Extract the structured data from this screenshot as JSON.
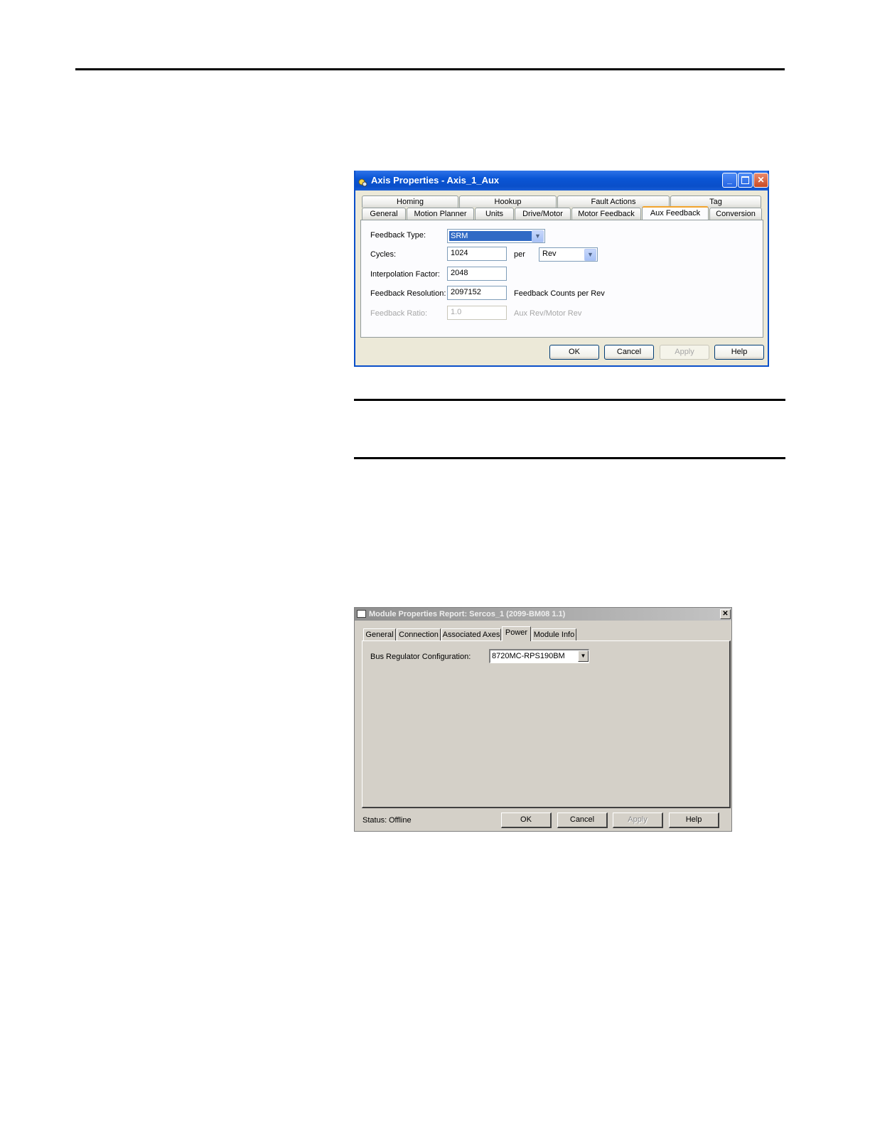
{
  "axis_dialog": {
    "title": "Axis Properties - Axis_1_Aux",
    "tabs_row1": [
      "Homing",
      "Hookup",
      "Fault Actions",
      "Tag"
    ],
    "tabs_row2": [
      "General",
      "Motion Planner",
      "Units",
      "Drive/Motor",
      "Motor Feedback",
      "Aux Feedback",
      "Conversion"
    ],
    "active_tab": "Aux Feedback",
    "feedback_type_label": "Feedback Type:",
    "feedback_type_value": "SRM",
    "cycles_label": "Cycles:",
    "cycles_value": "1024",
    "per_label": "per",
    "per_value": "Rev",
    "interpolation_label": "Interpolation Factor:",
    "interpolation_value": "2048",
    "resolution_label": "Feedback Resolution:",
    "resolution_value": "2097152",
    "resolution_units": "Feedback Counts per Rev",
    "ratio_label": "Feedback Ratio:",
    "ratio_value": "1.0",
    "ratio_units": "Aux Rev/Motor Rev",
    "buttons": {
      "ok": "OK",
      "cancel": "Cancel",
      "apply": "Apply",
      "help": "Help"
    }
  },
  "module_dialog": {
    "title": "Module Properties Report: Sercos_1 (2099-BM08 1.1)",
    "close_glyph": "✕",
    "tabs": [
      "General",
      "Connection",
      "Associated Axes",
      "Power",
      "Module Info"
    ],
    "active_tab": "Power",
    "bus_regulator_label": "Bus Regulator Configuration:",
    "bus_regulator_value": "8720MC-RPS190BM",
    "status_label": "Status:",
    "status_value": "Offline",
    "buttons": {
      "ok": "OK",
      "cancel": "Cancel",
      "apply": "Apply",
      "help": "Help"
    }
  },
  "colors": {
    "xp_title_blue": "#0a55d5",
    "xp_selected": "#316ac5",
    "classic_face": "#d4d0c8",
    "tab_highlight": "#f2a42d"
  }
}
